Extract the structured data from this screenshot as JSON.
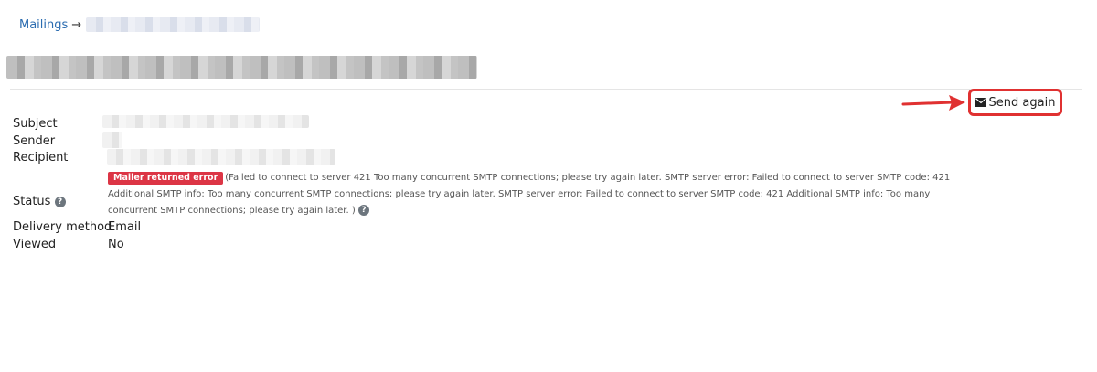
{
  "breadcrumb": {
    "root_label": "Mailings",
    "separator": "→"
  },
  "actions": {
    "send_again_label": "Send again"
  },
  "fields": {
    "subject_label": "Subject",
    "sender_label": "Sender",
    "recipient_label": "Recipient",
    "status_label": "Status",
    "delivery_method_label": "Delivery method",
    "delivery_method_value": "Email",
    "viewed_label": "Viewed",
    "viewed_value": "No"
  },
  "status": {
    "badge": "Mailer returned error",
    "message": "(Failed to connect to server 421 Too many concurrent SMTP connections; please try again later. SMTP server error: Failed to connect to server SMTP code: 421 Additional SMTP info: Too many concurrent SMTP connections; please try again later. SMTP server error: Failed to connect to server SMTP code: 421 Additional SMTP info: Too many concurrent SMTP connections; please try again later. )"
  },
  "icons": {
    "help": "question-circle-icon",
    "envelope": "envelope-icon",
    "annotation": "red-arrow"
  },
  "colors": {
    "link": "#2b6cb0",
    "badge": "#dc3545",
    "highlight": "#e03131"
  }
}
